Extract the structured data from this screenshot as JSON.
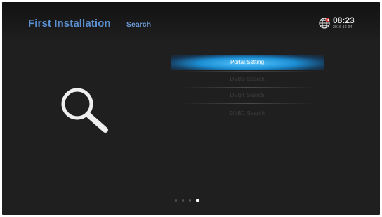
{
  "header": {
    "title": "First Installation",
    "subtitle": "Search",
    "time": "08:23",
    "date": "2016-12-04"
  },
  "icons": {
    "main": "search-icon",
    "status": "globe-icon"
  },
  "menu": {
    "items": [
      {
        "label": "Portal Setting",
        "selected": true
      },
      {
        "label": "DVBS Search",
        "selected": false
      },
      {
        "label": "DVBT Search",
        "selected": false
      },
      {
        "label": "DVBC Search",
        "selected": false
      }
    ]
  },
  "pagination": {
    "total": 4,
    "current": 4
  },
  "colors": {
    "accent": "#1c8fd4",
    "title": "#5b8fd0",
    "background": "#1f1f1f"
  }
}
